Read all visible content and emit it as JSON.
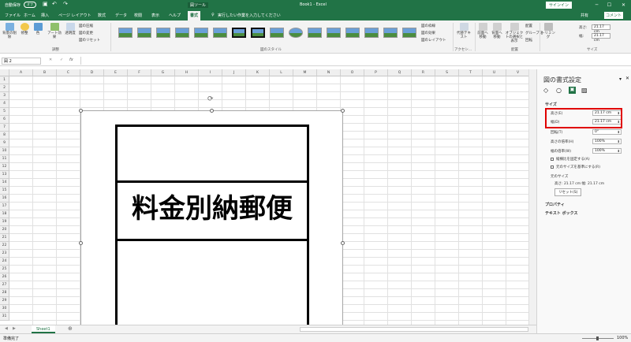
{
  "titlebar": {
    "autosave": "自動保存",
    "autosave_state": "オフ",
    "context_tool": "図ツール",
    "doc_title": "Book1 - Excel",
    "signin": "サインイン"
  },
  "tabs": [
    {
      "label": "ファイル"
    },
    {
      "label": "ホーム"
    },
    {
      "label": "挿入"
    },
    {
      "label": "ページ レイアウト"
    },
    {
      "label": "数式"
    },
    {
      "label": "データ"
    },
    {
      "label": "校閲"
    },
    {
      "label": "表示"
    },
    {
      "label": "ヘルプ"
    },
    {
      "label": "書式"
    }
  ],
  "search_hint": "実行したい作業を入力してください",
  "share": "共有",
  "comment": "コメント",
  "ribbon": {
    "adjust": {
      "remove_bg": "背景の削除",
      "corrections": "修整",
      "color": "色",
      "artistic": "アート効果",
      "transparency": "透明度",
      "compress": "図の圧縮",
      "change": "図の変更",
      "reset": "図のリセット",
      "group": "調整"
    },
    "styles": {
      "group": "図のスタイル",
      "border": "図の枠線",
      "effects": "図の効果",
      "layout": "図のレイアウト"
    },
    "access": {
      "alt_text": "代替テキスト",
      "group": "アクセシ..."
    },
    "arrange": {
      "forward": "前面へ移動",
      "backward": "背面へ移動",
      "selection": "オブジェクトの選択と表示",
      "align": "配置",
      "group_btn": "グループ化",
      "rotate": "回転",
      "group": "配置"
    },
    "size": {
      "crop": "トリミング",
      "height_label": "高さ:",
      "height": "21.17 cm",
      "width_label": "幅:",
      "width": "21.17 cm",
      "group": "サイズ"
    }
  },
  "formula": {
    "namebox": "図 2",
    "fx": "fx"
  },
  "columns": [
    "A",
    "B",
    "C",
    "D",
    "E",
    "F",
    "G",
    "H",
    "I",
    "J",
    "K",
    "L",
    "M",
    "N",
    "O",
    "P",
    "Q",
    "R",
    "S",
    "T",
    "U",
    "V"
  ],
  "rows": [
    "1",
    "2",
    "3",
    "4",
    "5",
    "6",
    "7",
    "8",
    "9",
    "10",
    "11",
    "12",
    "13",
    "14",
    "15",
    "16",
    "17",
    "18",
    "19",
    "20",
    "21",
    "22",
    "23",
    "24",
    "25",
    "26",
    "27",
    "28",
    "29",
    "30",
    "31"
  ],
  "stamp_text": "料金別納郵便",
  "sheet_tab": "Sheet1",
  "status": {
    "ready": "準備完了",
    "zoom": "100%"
  },
  "pane": {
    "title": "図の書式設定",
    "size_section": "サイズ",
    "height_label": "高さ(E)",
    "height": "21.17 cm",
    "width_label": "幅(D)",
    "width": "21.17 cm",
    "rotation_label": "回転(T)",
    "rotation": "0°",
    "scale_h_label": "高さの倍率(H)",
    "scale_h": "100%",
    "scale_w_label": "幅の倍率(W)",
    "scale_w": "100%",
    "lock_aspect": "縦横比を固定する(A)",
    "relative_original": "元のサイズを基準にする(R)",
    "original_size": "元のサイズ",
    "original_values": "高さ: 21.17 cm 幅: 21.17 cm",
    "reset": "リセット(S)",
    "properties": "プロパティ",
    "textbox": "テキスト ボックス"
  },
  "colors": {
    "excel_green": "#217346",
    "highlight": "#e00000"
  }
}
